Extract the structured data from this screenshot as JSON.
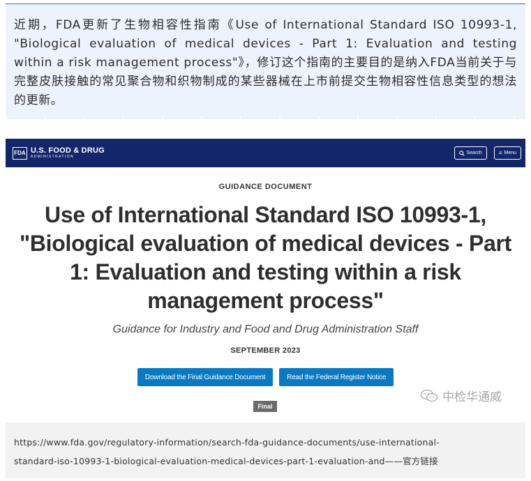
{
  "intro": {
    "text": "近期，FDA更新了生物相容性指南《Use of International Standard ISO 10993-1, \"Biological evaluation of medical devices - Part 1: Evaluation and testing within a risk management process\"》，修订这个指南的主要目的是纳入FDA当前关于与完整皮肤接触的常见聚合物和织物制成的某些器械在上市前提交生物相容性信息类型的想法的更新。"
  },
  "header": {
    "logo_mark": "FDA",
    "logo_main": "U.S. FOOD & DRUG",
    "logo_sub": "ADMINISTRATION",
    "search_label": "Search",
    "menu_label": "Menu"
  },
  "document": {
    "type": "GUIDANCE DOCUMENT",
    "title": "Use of International Standard ISO 10993-1, \"Biological evaluation of medical devices - Part 1: Evaluation and testing within a risk management process\"",
    "subtitle": "Guidance for Industry and Food and Drug Administration Staff",
    "date": "SEPTEMBER 2023",
    "download_button": "Download the Final Guidance Document",
    "federal_register_button": "Read the Federal Register Notice",
    "status": "Final"
  },
  "watermark": {
    "text": "中检华通威",
    "icon": "wechat-icon"
  },
  "footer": {
    "link_line1": "https://www.fda.gov/regulatory-information/search-fda-guidance-documents/use-international-",
    "link_line2": "standard-iso-10993-1-biological-evaluation-medical-devices-part-1-evaluation-and——官方链接"
  },
  "colors": {
    "header_bg": "#13266a",
    "button_bg": "#0b79c2",
    "intro_bg": "#edf3fc",
    "intro_border": "#3f6db6",
    "badge_bg": "#6b6b6b"
  }
}
